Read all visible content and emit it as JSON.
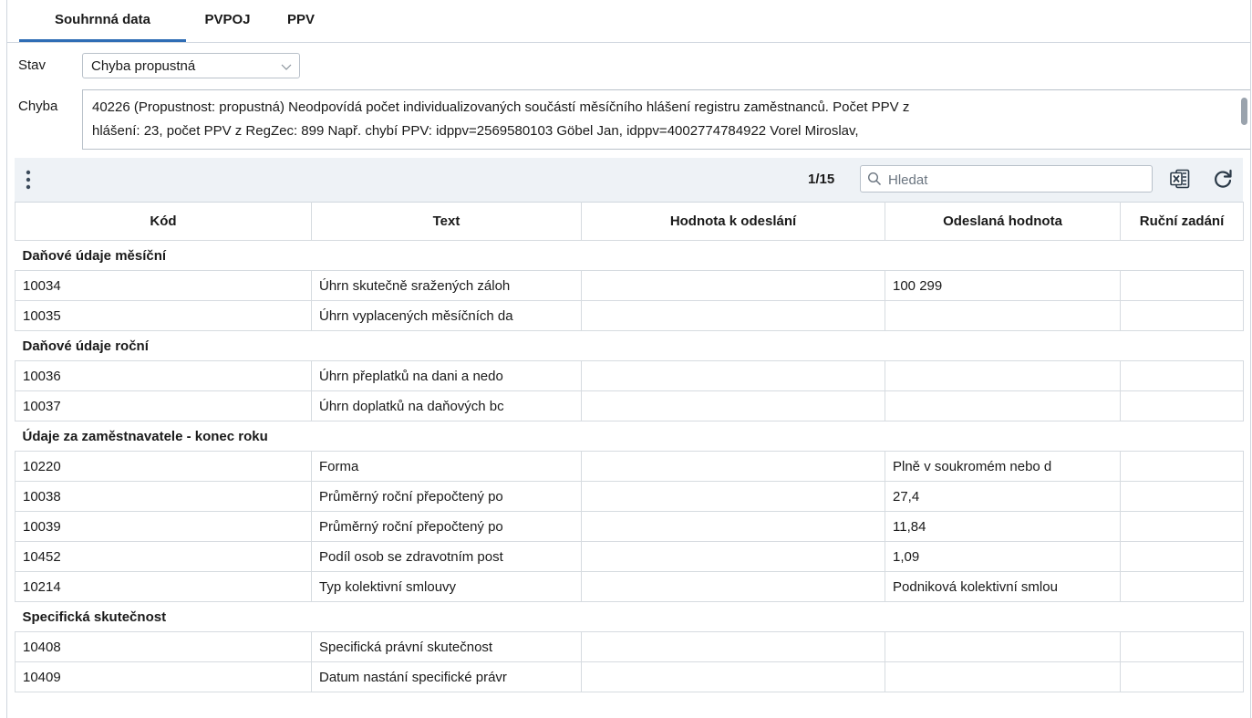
{
  "tabs": [
    {
      "label": "Souhrnná data",
      "active": true
    },
    {
      "label": "PVPOJ",
      "active": false
    },
    {
      "label": "PPV",
      "active": false
    }
  ],
  "filters": {
    "stav_label": "Stav",
    "stav_value": "Chyba propustná",
    "chyba_label": "Chyba",
    "chyba_text_line1": "40226 (Propustnost: propustná) Neodpovídá počet individualizovaných součástí měsíčního hlášení registru zaměstnanců. Počet PPV z",
    "chyba_text_line2": "hlášení: 23, počet PPV z RegZec: 899 Např. chybí PPV: idppv=2569580103 Göbel Jan, idppv=4002774784922 Vorel Miroslav,"
  },
  "toolbar": {
    "pager": "1/15",
    "search_placeholder": "Hledat",
    "icons": [
      "more-vert-icon",
      "search-icon",
      "excel-export-icon",
      "refresh-icon"
    ]
  },
  "table": {
    "columns": [
      "Kód",
      "Text",
      "Hodnota k odeslání",
      "Odeslaná hodnota",
      "Ruční zadání"
    ],
    "groups": [
      {
        "title": "Daňové údaje měsíční",
        "rows": [
          {
            "kod": "10034",
            "text": "Úhrn skutečně sražených záloh",
            "hodnota": "",
            "odeslana": "100 299",
            "rucni": ""
          },
          {
            "kod": "10035",
            "text": "Úhrn vyplacených měsíčních da",
            "hodnota": "",
            "odeslana": "",
            "rucni": ""
          }
        ]
      },
      {
        "title": "Daňové údaje roční",
        "rows": [
          {
            "kod": "10036",
            "text": "Úhrn přeplatků na dani a nedo",
            "hodnota": "",
            "odeslana": "",
            "rucni": ""
          },
          {
            "kod": "10037",
            "text": "Úhrn doplatků na daňových bc",
            "hodnota": "",
            "odeslana": "",
            "rucni": ""
          }
        ]
      },
      {
        "title": "Údaje za zaměstnavatele - konec roku",
        "rows": [
          {
            "kod": "10220",
            "text": "Forma",
            "hodnota": "",
            "odeslana": "Plně v soukromém nebo d",
            "rucni": ""
          },
          {
            "kod": "10038",
            "text": "Průměrný roční přepočtený po",
            "hodnota": "",
            "odeslana": "27,4",
            "rucni": ""
          },
          {
            "kod": "10039",
            "text": "Průměrný roční přepočtený po",
            "hodnota": "",
            "odeslana": "11,84",
            "rucni": ""
          },
          {
            "kod": "10452",
            "text": "Podíl osob se zdravotním post",
            "hodnota": "",
            "odeslana": "1,09",
            "rucni": ""
          },
          {
            "kod": "10214",
            "text": "Typ kolektivní smlouvy",
            "hodnota": "",
            "odeslana": "Podniková kolektivní smlou",
            "rucni": ""
          }
        ]
      },
      {
        "title": "Specifická skutečnost",
        "rows": [
          {
            "kod": "10408",
            "text": "Specifická právní skutečnost",
            "hodnota": "",
            "odeslana": "",
            "rucni": ""
          },
          {
            "kod": "10409",
            "text": "Datum nastání specifické právr",
            "hodnota": "",
            "odeslana": "",
            "rucni": ""
          }
        ]
      }
    ]
  }
}
